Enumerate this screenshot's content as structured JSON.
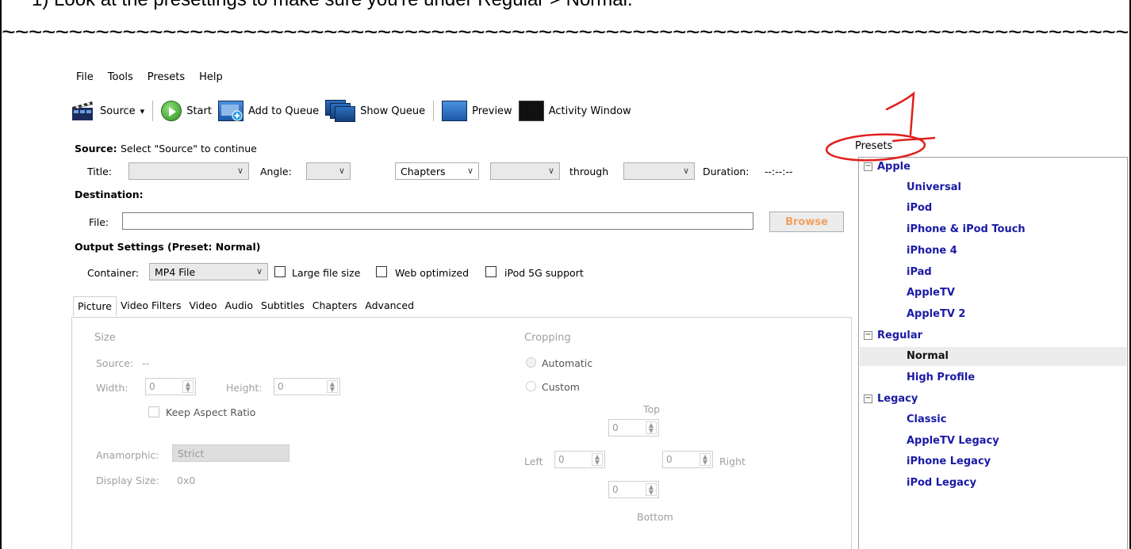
{
  "instruction": "1)  Look at the presettings to make sure you're under Regular > Normal.",
  "separator": "~~~~~~~~~~~~~~~~~~~~~~~~~~~~~~~~~~~~~~~~~~~~~~~~~~~~~~~~~~~~~~~~~~~~~~~~~~~~~~~~~~~~~~~~~",
  "annotation_number": "1",
  "menu": [
    "File",
    "Tools",
    "Presets",
    "Help"
  ],
  "toolbar": {
    "source": "Source",
    "source_dropdown": "▾",
    "start": "Start",
    "add_to_queue": "Add to Queue",
    "show_queue": "Show Queue",
    "preview": "Preview",
    "activity_window": "Activity Window"
  },
  "source": {
    "label": "Source:",
    "value": "Select \"Source\" to continue",
    "title_label": "Title:",
    "angle_label": "Angle:",
    "chapters_value": "Chapters",
    "through_label": "through",
    "duration_label": "Duration:",
    "duration_value": "--:--:--"
  },
  "destination": {
    "label": "Destination:",
    "file_label": "File:",
    "file_value": "",
    "browse": "Browse"
  },
  "output": {
    "label": "Output Settings (Preset: Normal)",
    "container_label": "Container:",
    "container_value": "MP4 File",
    "large_file": "Large file size",
    "web_optimized": "Web optimized",
    "ipod_5g": "iPod 5G support"
  },
  "tabs": [
    "Picture",
    "Video Filters",
    "Video",
    "Audio",
    "Subtitles",
    "Chapters",
    "Advanced"
  ],
  "active_tab": "Picture",
  "picture": {
    "size_heading": "Size",
    "source_label": "Source:",
    "source_value": "--",
    "width_label": "Width:",
    "width_value": "0",
    "height_label": "Height:",
    "height_value": "0",
    "keep_aspect": "Keep Aspect Ratio",
    "anamorphic_label": "Anamorphic:",
    "anamorphic_value": "Strict",
    "display_size_label": "Display Size:",
    "display_size_value": "0x0",
    "cropping_heading": "Cropping",
    "automatic": "Automatic",
    "custom": "Custom",
    "top": "Top",
    "left": "Left",
    "right": "Right",
    "bottom": "Bottom",
    "top_value": "0",
    "left_value": "0",
    "right_value": "0",
    "bottom_value": "0"
  },
  "presets": {
    "title": "Presets",
    "groups": [
      {
        "name": "Apple",
        "items": [
          "Universal",
          "iPod",
          "iPhone & iPod Touch",
          "iPhone 4",
          "iPad",
          "AppleTV",
          "AppleTV 2"
        ]
      },
      {
        "name": "Regular",
        "items": [
          "Normal",
          "High Profile"
        ]
      },
      {
        "name": "Legacy",
        "items": [
          "Classic",
          "AppleTV Legacy",
          "iPhone Legacy",
          "iPod Legacy"
        ]
      }
    ],
    "collapse_symbol": "−",
    "selected": "Normal"
  },
  "colors": {
    "preset_link": "#1a1aa6",
    "annotation_red": "#e0201c",
    "browse_text": "#f0a060"
  }
}
